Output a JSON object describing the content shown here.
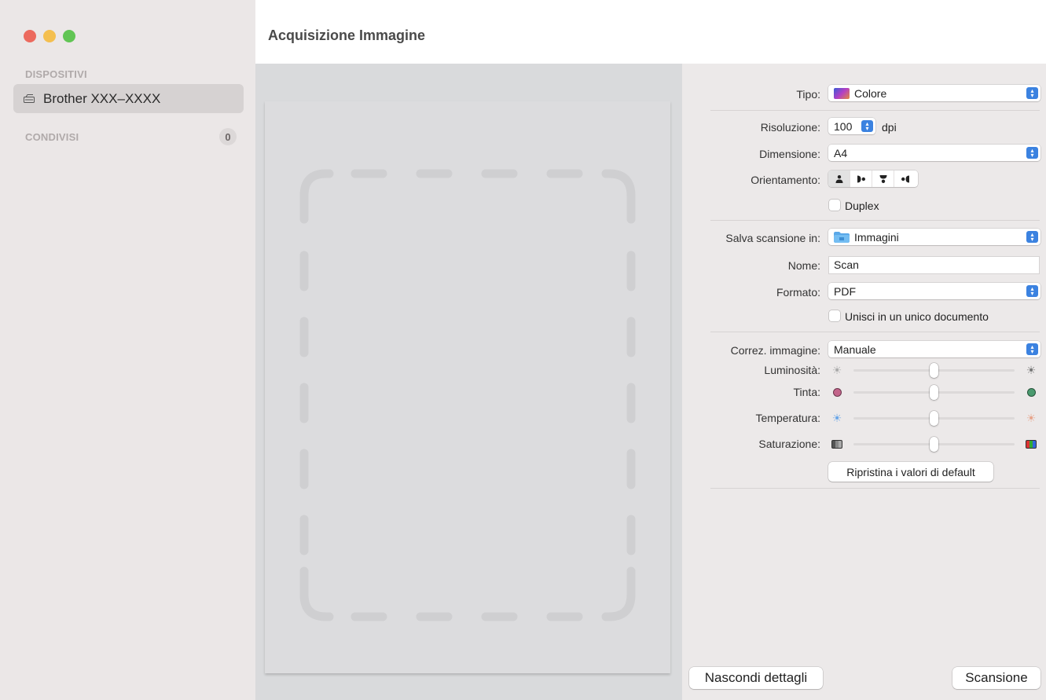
{
  "window": {
    "title": "Acquisizione Immagine"
  },
  "sidebar": {
    "devices_header": "DISPOSITIVI",
    "device": "Brother XXX–XXXX",
    "shared_header": "CONDIVISI",
    "shared_count": "0"
  },
  "settings": {
    "tipo_label": "Tipo:",
    "tipo_value": "Colore",
    "risoluzione_label": "Risoluzione:",
    "risoluzione_value": "100",
    "risoluzione_unit": "dpi",
    "dimensione_label": "Dimensione:",
    "dimensione_value": "A4",
    "orientamento_label": "Orientamento:",
    "duplex_label": "Duplex",
    "duplex_checked": false,
    "salva_label": "Salva scansione in:",
    "salva_value": "Immagini",
    "nome_label": "Nome:",
    "nome_value": "Scan",
    "formato_label": "Formato:",
    "formato_value": "PDF",
    "unisci_label": "Unisci in un unico documento",
    "unisci_checked": false,
    "correz_label": "Correz. immagine:",
    "correz_value": "Manuale",
    "luminosita_label": "Luminosità:",
    "tinta_label": "Tinta:",
    "temperatura_label": "Temperatura:",
    "saturazione_label": "Saturazione:",
    "reset_button": "Ripristina i valori di default",
    "sliders": {
      "luminosita": 0.5,
      "tinta": 0.5,
      "temperatura": 0.5,
      "saturazione": 0.5
    }
  },
  "footer": {
    "hide_details": "Nascondi dettagli",
    "scan": "Scansione"
  },
  "colors": {
    "accent": "#3b82e0",
    "sidebar_bg": "#ebe7e7",
    "panel_bg": "#ece9e9",
    "preview_bg": "#d9dadc"
  }
}
